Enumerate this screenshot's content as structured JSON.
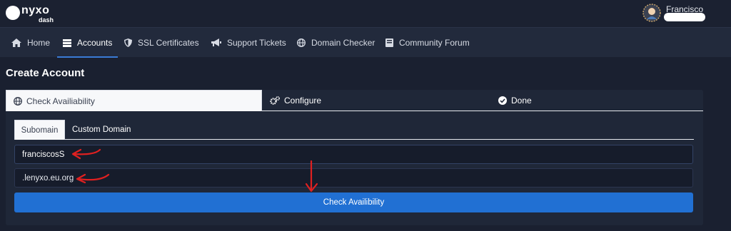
{
  "header": {
    "brand": "nyxo",
    "brand_sub": "dash",
    "user_name": "Francisco"
  },
  "nav": {
    "items": [
      {
        "label": "Home",
        "icon": "home-icon"
      },
      {
        "label": "Accounts",
        "icon": "server-icon",
        "active": true
      },
      {
        "label": "SSL Certificates",
        "icon": "shield-icon"
      },
      {
        "label": "Support Tickets",
        "icon": "megaphone-icon"
      },
      {
        "label": "Domain Checker",
        "icon": "globe-icon"
      },
      {
        "label": "Community Forum",
        "icon": "book-icon"
      }
    ]
  },
  "page": {
    "title": "Create Account"
  },
  "steps": [
    {
      "label": "Check Availiability",
      "icon": "globe-icon",
      "active": true
    },
    {
      "label": "Configure",
      "icon": "cogs-icon"
    },
    {
      "label": "Done",
      "icon": "check-circle-icon"
    }
  ],
  "sub_tabs": [
    {
      "label": "Subomain",
      "active": true
    },
    {
      "label": "Custom Domain"
    }
  ],
  "form": {
    "subdomain_value": "franciscosS",
    "domain_suffix": ".lenyxo.eu.org",
    "check_button": "Check Availibility"
  },
  "colors": {
    "background": "#1a2030",
    "nav": "#222a3c",
    "accent": "#2170d3",
    "annotation": "#e02020"
  }
}
